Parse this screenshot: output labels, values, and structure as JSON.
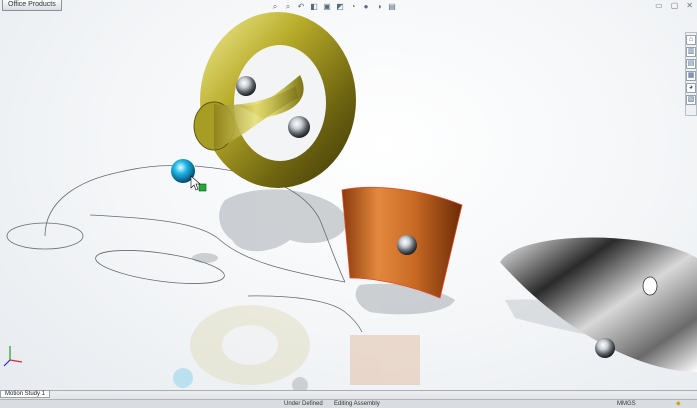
{
  "office_tab": "Office Products",
  "motion_study_tab": "Motion Study 1",
  "status": {
    "under_defined": "Under Defined",
    "editing": "Editing Assembly",
    "units": "MMGS"
  },
  "toolbar_icons": [
    "zoom-fit-icon",
    "zoom-area-icon",
    "previous-view-icon",
    "section-view-icon",
    "view-orientation-icon",
    "display-style-icon",
    "hide-show-icon",
    "appearance-icon",
    "scene-icon",
    "view-settings-icon"
  ],
  "task_pane_icons": [
    "solidworks-resources-icon",
    "design-library-icon",
    "file-explorer-icon",
    "view-palette-icon",
    "appearances-icon",
    "custom-properties-icon"
  ]
}
